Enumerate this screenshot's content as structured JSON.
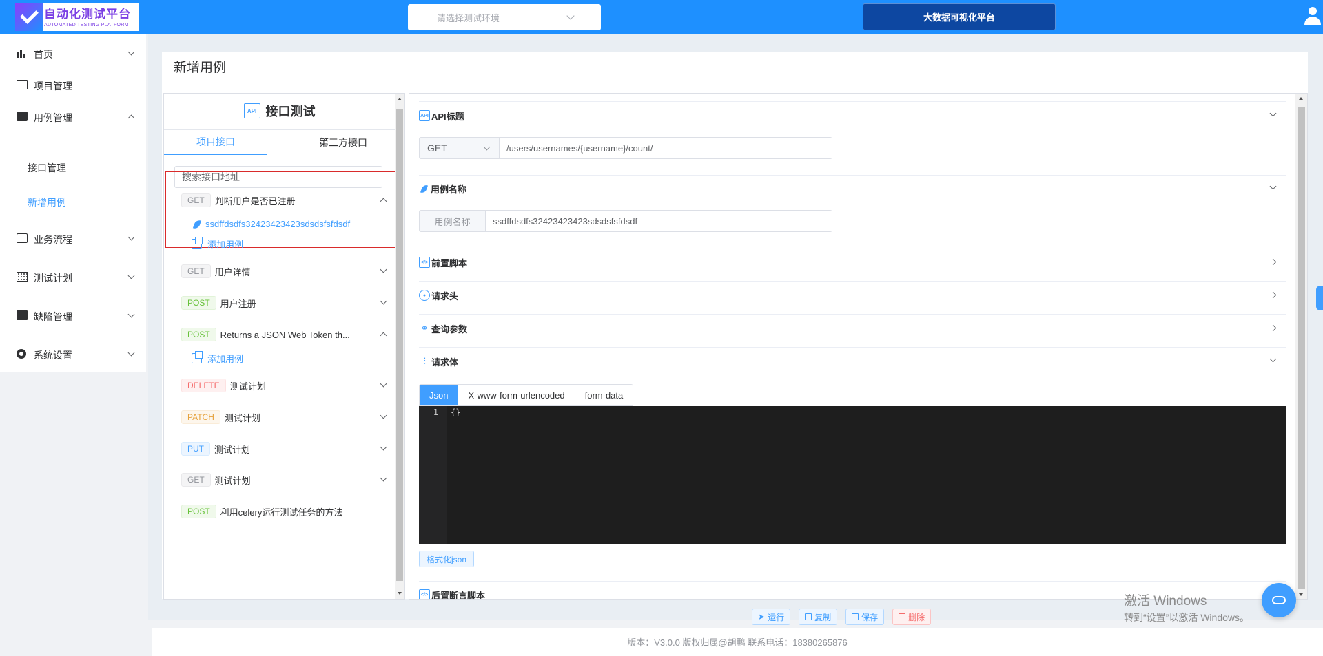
{
  "header": {
    "logo_title": "自动化测试平台",
    "logo_subtitle": "AUTOMATED TESTING PLATFORM",
    "env_placeholder": "请选择测试环境",
    "bigdata_label": "大数据可视化平台"
  },
  "sidebar": {
    "items": [
      {
        "label": "首页",
        "icon": "bar-chart-icon"
      },
      {
        "label": "项目管理",
        "icon": "folder-icon"
      },
      {
        "label": "用例管理",
        "icon": "briefcase-icon"
      },
      {
        "label": "业务流程",
        "icon": "flow-icon"
      },
      {
        "label": "测试计划",
        "icon": "calendar-icon"
      },
      {
        "label": "缺陷管理",
        "icon": "line-chart-icon"
      },
      {
        "label": "系统设置",
        "icon": "gear-icon"
      }
    ],
    "sub_items": [
      {
        "label": "接口管理",
        "active": false
      },
      {
        "label": "新增用例",
        "active": true
      }
    ]
  },
  "page": {
    "title": "新增用例"
  },
  "left_panel": {
    "title": "接口测试",
    "tabs": [
      "项目接口",
      "第三方接口"
    ],
    "search_placeholder": "搜索接口地址",
    "apis": [
      {
        "method": "GET",
        "name": "判断用户是否已注册",
        "expanded": true
      },
      {
        "method": "GET",
        "name": "用户详情",
        "expanded": false
      },
      {
        "method": "POST",
        "name": "用户注册",
        "expanded": false
      },
      {
        "method": "POST",
        "name": "Returns a JSON Web Token th...",
        "expanded": true
      },
      {
        "method": "DELETE",
        "name": "测试计划",
        "expanded": false
      },
      {
        "method": "PATCH",
        "name": "测试计划",
        "expanded": false
      },
      {
        "method": "PUT",
        "name": "测试计划",
        "expanded": false
      },
      {
        "method": "GET",
        "name": "测试计划",
        "expanded": false
      },
      {
        "method": "POST",
        "name": "利用celery运行测试任务的方法",
        "expanded": false
      }
    ],
    "case_name": "ssdffdsdfs32423423423sdsdsfsfdsdf",
    "add_case_label": "添加用例"
  },
  "right_panel": {
    "sections": {
      "api_title": "API标题",
      "case_name": "用例名称",
      "pre_script": "前置脚本",
      "headers": "请求头",
      "query": "查询参数",
      "body": "请求体",
      "post_script": "后置断言脚本"
    },
    "method_value": "GET",
    "url_value": "/users/usernames/{username}/count/",
    "name_prepend": "用例名称",
    "name_value": "ssdffdsdfs32423423423sdsdsfsfdsdf",
    "body_tabs": [
      "Json",
      "X-www-form-urlencoded",
      "form-data"
    ],
    "code_line_no": "1",
    "code_text": "{}",
    "format_btn": "格式化json"
  },
  "actions": {
    "run": "运行",
    "copy": "复制",
    "save": "保存",
    "delete": "删除"
  },
  "footer": {
    "text": "版本：V3.0.0 版权归属@胡鹏 联系电话：18380265876"
  },
  "watermark": {
    "line1": "激活 Windows",
    "line2": "转到“设置”以激活 Windows。"
  },
  "colors": {
    "header": "#1e90ff",
    "primary": "#409eff",
    "highlight": "#d92b2b"
  }
}
